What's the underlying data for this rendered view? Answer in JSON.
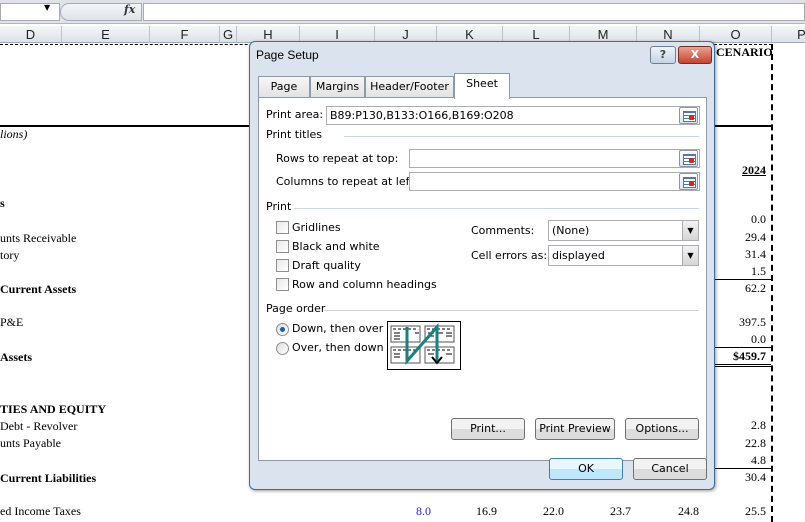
{
  "formula_bar": {
    "fx_label": "fx",
    "value": ""
  },
  "columns": [
    "D",
    "E",
    "F",
    "G",
    "H",
    "I",
    "J",
    "K",
    "L",
    "M",
    "N",
    "O",
    "P"
  ],
  "sheet": {
    "header_fragment": "CENARIO",
    "units_fragment": "lions)",
    "year": "2024",
    "rows": [
      {
        "label": "s",
        "bold": true,
        "value": ""
      },
      {
        "label": "",
        "value": "0.0"
      },
      {
        "label": "unts Receivable",
        "value": "29.4"
      },
      {
        "label": "tory",
        "value": "31.4"
      },
      {
        "label": "",
        "value": "1.5"
      },
      {
        "label": "Current Assets",
        "bold": true,
        "value": "62.2"
      },
      {
        "label": "P&E",
        "value": "397.5"
      },
      {
        "label": "",
        "value": "0.0"
      },
      {
        "label": "Assets",
        "bold": true,
        "value": "$459.7"
      },
      {
        "label": "TIES AND EQUITY",
        "bold": true,
        "value": ""
      },
      {
        "label": "Debt - Revolver",
        "value": "2.8"
      },
      {
        "label": "unts Payable",
        "value": "22.8"
      },
      {
        "label": "",
        "value": "4.8"
      },
      {
        "label": "Current Liabilities",
        "bold": true,
        "value": "30.4"
      },
      {
        "label": "ed Income Taxes",
        "value": "25.5",
        "row_values": [
          "8.0",
          "16.9",
          "22.0",
          "23.7",
          "24.8"
        ]
      }
    ]
  },
  "dialog": {
    "title": "Page Setup",
    "help": "?",
    "close": "X",
    "tabs": [
      "Page",
      "Margins",
      "Header/Footer",
      "Sheet"
    ],
    "active_tab": "Sheet",
    "print_area_label": "Print area:",
    "print_area_value": "B89:P130,B133:O166,B169:O208",
    "print_titles_heading": "Print titles",
    "rows_repeat_label": "Rows to repeat at top:",
    "rows_repeat_value": "",
    "cols_repeat_label": "Columns to repeat at left:",
    "cols_repeat_value": "",
    "print_heading": "Print",
    "checkboxes": [
      "Gridlines",
      "Black and white",
      "Draft quality",
      "Row and column headings"
    ],
    "comments_label": "Comments:",
    "comments_value": "(None)",
    "cell_errors_label": "Cell errors as:",
    "cell_errors_value": "displayed",
    "page_order_heading": "Page order",
    "radios": [
      "Down, then over",
      "Over, then down"
    ],
    "selected_radio": "Down, then over",
    "buttons": {
      "print": "Print...",
      "print_preview": "Print Preview",
      "options": "Options...",
      "ok": "OK",
      "cancel": "Cancel"
    },
    "accent": "#1a8080"
  }
}
